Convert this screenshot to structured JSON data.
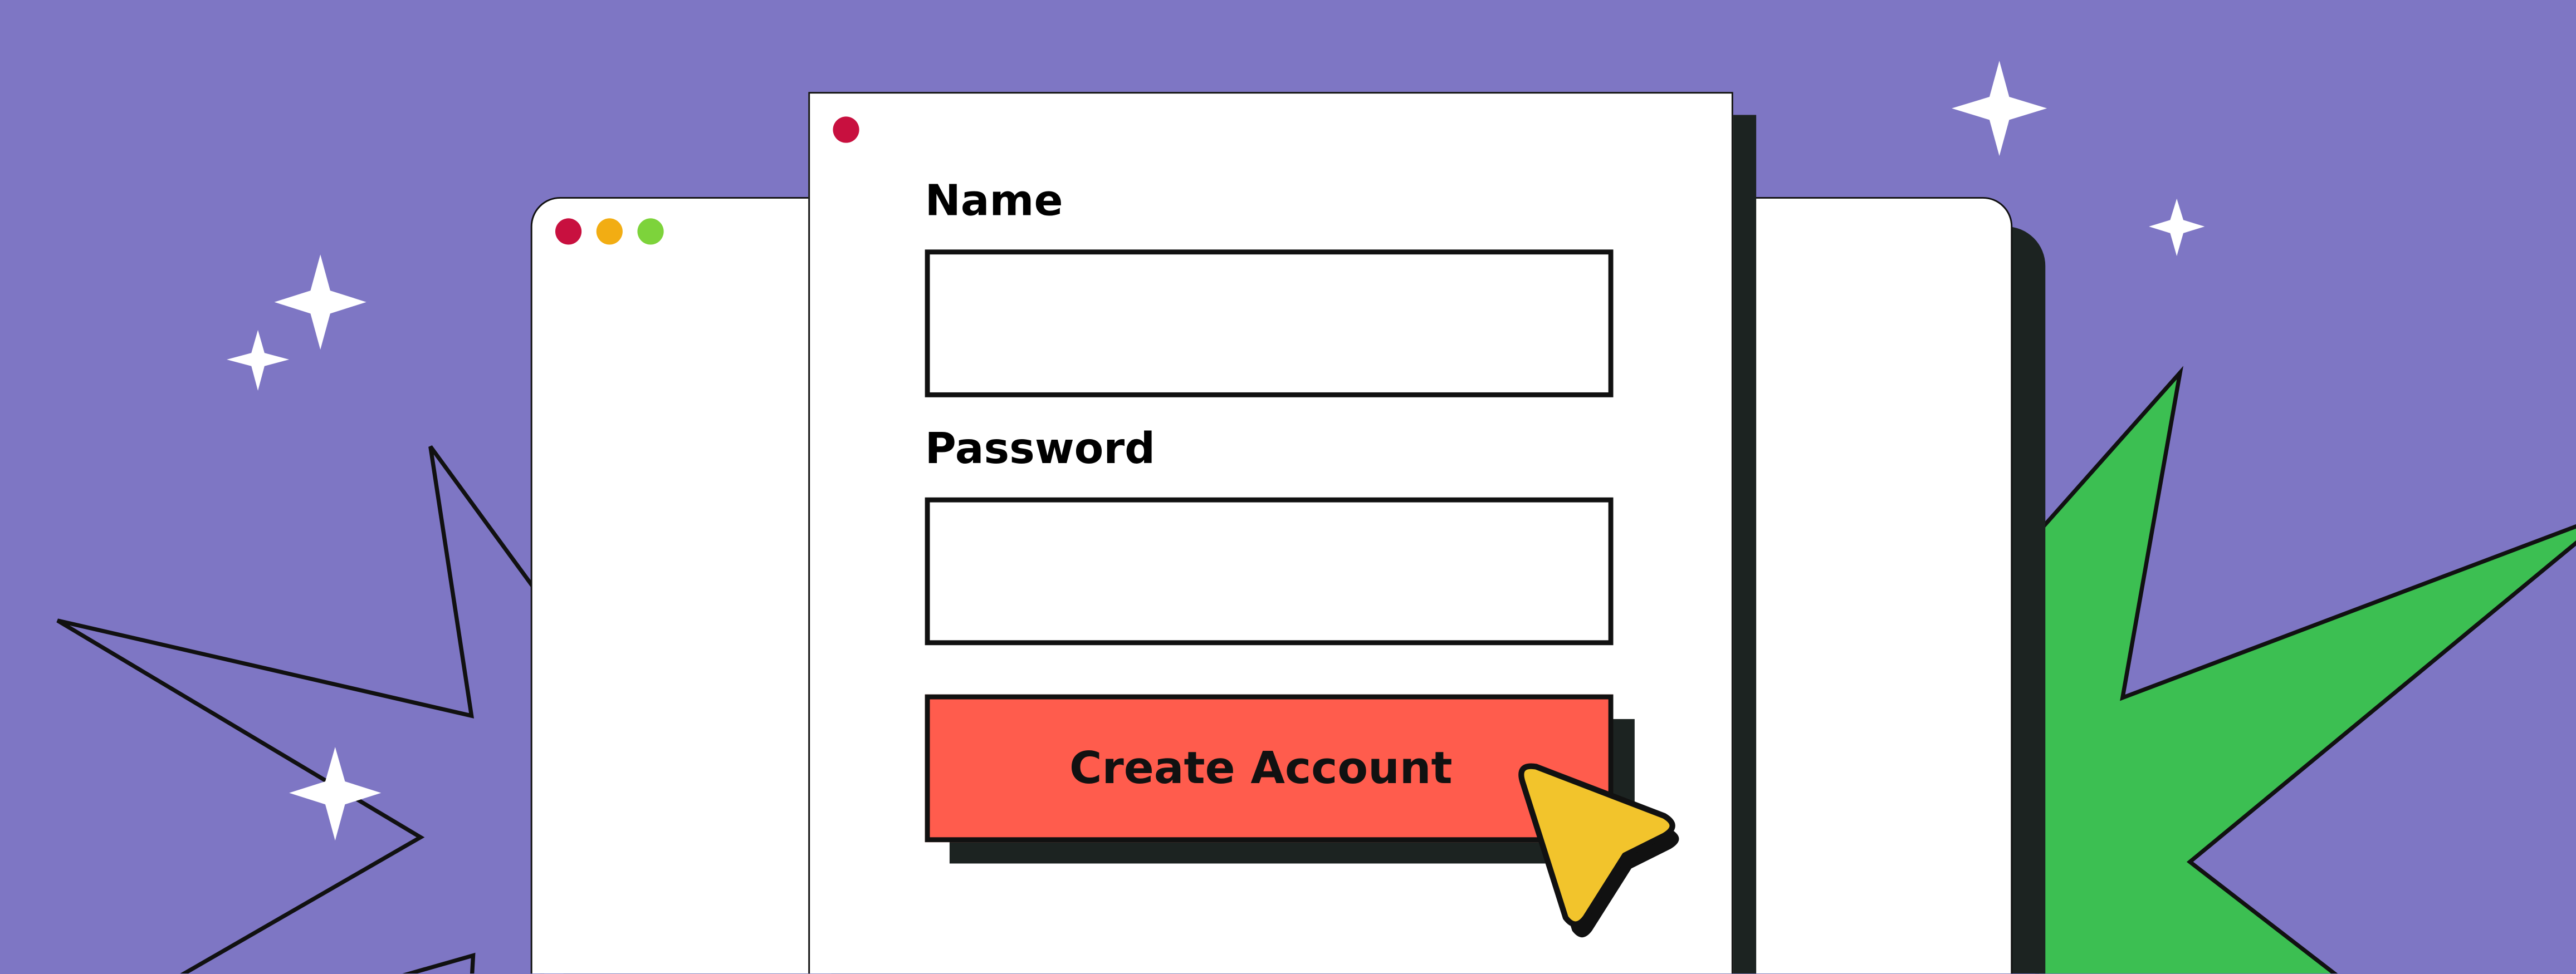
{
  "colors": {
    "background": "#7e76c4",
    "burst_green": "#3cbf52",
    "button": "#ff5c4d",
    "cursor": "#f2c42c",
    "shadow": "#1c2321",
    "dot_red": "#c8103f",
    "dot_yellow": "#f2ad13",
    "dot_green": "#7dd33b"
  },
  "window_controls": [
    "close-dot",
    "minimize-dot",
    "maximize-dot"
  ],
  "form": {
    "name_label": "Name",
    "name_value": "",
    "password_label": "Password",
    "password_value": "",
    "submit_label": "Create Account"
  },
  "icons": {
    "cursor": "pointer-arrow-icon",
    "sparkle": "sparkle-star-icon"
  }
}
